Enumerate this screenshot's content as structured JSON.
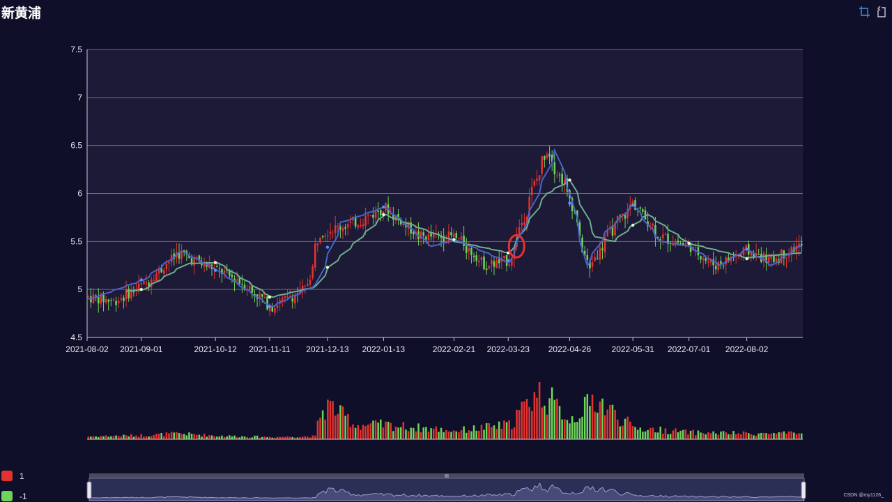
{
  "page": {
    "title": "新黄浦",
    "watermark": "CSDN @roy1126_"
  },
  "toolbox": [
    {
      "name": "zoom-select-icon",
      "color": "#4a90d9"
    },
    {
      "name": "zoom-reset-icon",
      "color": "#c8c8d8"
    }
  ],
  "legend": [
    {
      "label": "1",
      "color": "#e4332e"
    },
    {
      "label": "-1",
      "color": "#6fd45a"
    }
  ],
  "colors": {
    "up": "#e4332e",
    "down": "#6fd45a",
    "ma_fast": "#4a63c9",
    "ma_slow": "#6fae8e",
    "highlight_circle": "#e4332e",
    "plot_band": "#1c1a36",
    "grid": "#6b6b80"
  },
  "chart_data": {
    "type": "candlestick",
    "title": "新黄浦",
    "ylim": [
      4.5,
      7.5
    ],
    "y_ticks": [
      "4.5",
      "5",
      "5.5",
      "6",
      "6.5",
      "7",
      "7.5"
    ],
    "x_ticks": [
      "2021-08-02",
      "2021-09-01",
      "2021-10-12",
      "2021-11-11",
      "2021-12-13",
      "2022-01-13",
      "2022-02-21",
      "2022-03-23",
      "2022-04-26",
      "2022-05-31",
      "2022-07-01",
      "2022-08-02"
    ],
    "price_anchors": [
      [
        "2021-08-02",
        4.92
      ],
      [
        "2021-08-16",
        4.88
      ],
      [
        "2021-09-01",
        5.05
      ],
      [
        "2021-09-20",
        5.38
      ],
      [
        "2021-10-12",
        5.2
      ],
      [
        "2021-10-25",
        5.08
      ],
      [
        "2021-11-11",
        4.82
      ],
      [
        "2021-11-30",
        5.0
      ],
      [
        "2021-12-08",
        5.6
      ],
      [
        "2021-12-13",
        5.62
      ],
      [
        "2021-12-28",
        5.7
      ],
      [
        "2022-01-13",
        5.85
      ],
      [
        "2022-02-01",
        5.55
      ],
      [
        "2022-02-21",
        5.55
      ],
      [
        "2022-03-10",
        5.25
      ],
      [
        "2022-03-23",
        5.3
      ],
      [
        "2022-04-06",
        6.1
      ],
      [
        "2022-04-13",
        6.45
      ],
      [
        "2022-04-26",
        5.95
      ],
      [
        "2022-05-06",
        5.2
      ],
      [
        "2022-05-16",
        5.55
      ],
      [
        "2022-05-31",
        5.9
      ],
      [
        "2022-06-15",
        5.55
      ],
      [
        "2022-07-01",
        5.45
      ],
      [
        "2022-07-15",
        5.25
      ],
      [
        "2022-08-02",
        5.4
      ],
      [
        "2022-08-15",
        5.3
      ],
      [
        "2022-08-31",
        5.45
      ]
    ],
    "ma_fast_anchors": [
      [
        "2021-08-02",
        4.9
      ],
      [
        "2021-09-01",
        5.1
      ],
      [
        "2021-09-22",
        5.4
      ],
      [
        "2021-10-12",
        5.2
      ],
      [
        "2021-11-11",
        4.82
      ],
      [
        "2021-12-06",
        5.05
      ],
      [
        "2021-12-20",
        5.7
      ],
      [
        "2022-01-13",
        5.86
      ],
      [
        "2022-02-08",
        5.45
      ],
      [
        "2022-02-21",
        5.52
      ],
      [
        "2022-03-23",
        5.28
      ],
      [
        "2022-04-18",
        6.45
      ],
      [
        "2022-04-26",
        6.0
      ],
      [
        "2022-05-05",
        5.25
      ],
      [
        "2022-05-16",
        5.6
      ],
      [
        "2022-05-31",
        5.88
      ],
      [
        "2022-06-15",
        5.5
      ],
      [
        "2022-07-01",
        5.45
      ],
      [
        "2022-07-18",
        5.25
      ],
      [
        "2022-08-02",
        5.42
      ],
      [
        "2022-08-16",
        5.25
      ],
      [
        "2022-08-31",
        5.45
      ]
    ],
    "ma_slow_anchors": [
      [
        "2021-08-22",
        4.98
      ],
      [
        "2021-09-01",
        5.0
      ],
      [
        "2021-09-25",
        5.27
      ],
      [
        "2021-10-12",
        5.28
      ],
      [
        "2021-11-11",
        4.92
      ],
      [
        "2021-12-06",
        5.03
      ],
      [
        "2021-12-13",
        5.23
      ],
      [
        "2022-01-13",
        5.78
      ],
      [
        "2022-02-21",
        5.5
      ],
      [
        "2022-03-23",
        5.38
      ],
      [
        "2022-04-13",
        6.0
      ],
      [
        "2022-04-26",
        6.14
      ],
      [
        "2022-05-10",
        5.55
      ],
      [
        "2022-05-20",
        5.5
      ],
      [
        "2022-05-31",
        5.67
      ],
      [
        "2022-06-08",
        5.78
      ],
      [
        "2022-07-01",
        5.48
      ],
      [
        "2022-08-02",
        5.33
      ],
      [
        "2022-08-31",
        5.38
      ]
    ],
    "ma_markers": [
      {
        "series": "fast",
        "x": "2021-09-01",
        "y": 5.1
      },
      {
        "series": "fast",
        "x": "2021-10-12",
        "y": 5.2
      },
      {
        "series": "fast",
        "x": "2021-11-11",
        "y": 4.82
      },
      {
        "series": "fast",
        "x": "2021-12-13",
        "y": 5.44
      },
      {
        "series": "fast",
        "x": "2022-01-13",
        "y": 5.86
      },
      {
        "series": "fast",
        "x": "2022-02-21",
        "y": 5.52
      },
      {
        "series": "fast",
        "x": "2022-03-23",
        "y": 5.3
      },
      {
        "series": "fast",
        "x": "2022-04-26",
        "y": 5.9
      },
      {
        "series": "fast",
        "x": "2022-05-31",
        "y": 5.88
      },
      {
        "series": "fast",
        "x": "2022-07-01",
        "y": 5.48
      },
      {
        "series": "fast",
        "x": "2022-08-02",
        "y": 5.42
      },
      {
        "series": "slow",
        "x": "2021-09-01",
        "y": 5.0
      },
      {
        "series": "slow",
        "x": "2021-10-12",
        "y": 5.28
      },
      {
        "series": "slow",
        "x": "2021-11-11",
        "y": 4.92
      },
      {
        "series": "slow",
        "x": "2021-12-13",
        "y": 5.23
      },
      {
        "series": "slow",
        "x": "2022-01-13",
        "y": 5.78
      },
      {
        "series": "slow",
        "x": "2022-02-21",
        "y": 5.52
      },
      {
        "series": "slow",
        "x": "2022-03-23",
        "y": 5.38
      },
      {
        "series": "slow",
        "x": "2022-04-26",
        "y": 6.14
      },
      {
        "series": "slow",
        "x": "2022-05-31",
        "y": 5.67
      },
      {
        "series": "slow",
        "x": "2022-07-01",
        "y": 5.48
      },
      {
        "series": "slow",
        "x": "2022-08-02",
        "y": 5.32
      }
    ],
    "highlight": {
      "x": "2022-03-23",
      "y": 5.45
    },
    "volume_anchors": [
      [
        "2021-08-02",
        0.05
      ],
      [
        "2021-09-01",
        0.07
      ],
      [
        "2021-09-20",
        0.1
      ],
      [
        "2021-10-12",
        0.06
      ],
      [
        "2021-11-11",
        0.04
      ],
      [
        "2021-12-06",
        0.05
      ],
      [
        "2021-12-08",
        0.45
      ],
      [
        "2021-12-13",
        0.6
      ],
      [
        "2021-12-28",
        0.25
      ],
      [
        "2022-01-13",
        0.25
      ],
      [
        "2022-02-21",
        0.15
      ],
      [
        "2022-03-23",
        0.25
      ],
      [
        "2022-04-08",
        0.85
      ],
      [
        "2022-04-26",
        0.35
      ],
      [
        "2022-05-10",
        0.7
      ],
      [
        "2022-05-31",
        0.2
      ],
      [
        "2022-07-01",
        0.12
      ],
      [
        "2022-08-02",
        0.1
      ],
      [
        "2022-08-31",
        0.1
      ]
    ]
  }
}
